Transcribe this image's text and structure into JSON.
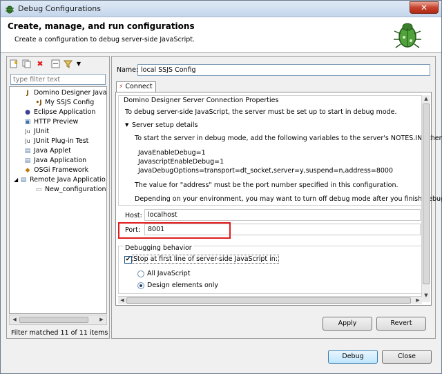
{
  "window": {
    "title": "Debug Configurations",
    "close_glyph": "✕"
  },
  "header": {
    "title": "Create, manage, and run configurations",
    "subtitle": "Create a configuration to debug server-side JavaScript."
  },
  "sidebar": {
    "filter_placeholder": "type filter text",
    "tree": [
      {
        "label": "Domino Designer JavaSc",
        "icon": "domino-js-icon",
        "glyph": "J"
      },
      {
        "label": "My SSJS Config",
        "icon": "js-config-icon",
        "glyph": "•J"
      },
      {
        "label": "Eclipse Application",
        "icon": "eclipse-icon",
        "glyph": "●"
      },
      {
        "label": "HTTP Preview",
        "icon": "http-icon",
        "glyph": "▣"
      },
      {
        "label": "JUnit",
        "icon": "junit-icon",
        "glyph": "Ju"
      },
      {
        "label": "JUnit Plug-in Test",
        "icon": "junit-plugin-icon",
        "glyph": "Ju"
      },
      {
        "label": "Java Applet",
        "icon": "applet-icon",
        "glyph": "▤"
      },
      {
        "label": "Java Application",
        "icon": "java-app-icon",
        "glyph": "▤"
      },
      {
        "label": "OSGi Framework",
        "icon": "osgi-icon",
        "glyph": "◆"
      },
      {
        "label": "Remote Java Applicatio",
        "icon": "remote-java-icon",
        "glyph": "▤"
      },
      {
        "label": "New_configuration",
        "icon": "config-icon",
        "glyph": "▭"
      }
    ],
    "status": "Filter matched 11 of 11 items"
  },
  "main": {
    "name_label": "Name:",
    "name_value": "local SSJS Config",
    "tab_label": "Connect",
    "group_title": "Domino Designer Server Connection Properties",
    "intro": "To debug server-side JavaScript, the server must be set up to start in debug mode.",
    "section_title": "Server setup details",
    "setup_text": "To start the server in debug mode, add the following variables to the server's NOTES.INI, then resta",
    "var1": "JavaEnableDebug=1",
    "var2": "JavascriptEnableDebug=1",
    "var3": "JavaDebugOptions=transport=dt_socket,server=y,suspend=n,address=8000",
    "address_note": "The value for \"address\" must be the port number specified in this configuration.",
    "env_note": "Depending on your environment, you may want to turn off debug mode after you finish debuggin",
    "host_label": "Host:",
    "host_value": "localhost",
    "port_label": "Port:",
    "port_value": "8001",
    "debug_group_title": "Debugging behavior",
    "stop_label": "Stop at first line of server-side JavaScript in:",
    "stop_checked": true,
    "radio_all": "All JavaScript",
    "radio_design": "Design elements only",
    "apply_label": "Apply",
    "revert_label": "Revert"
  },
  "footer": {
    "debug_label": "Debug",
    "close_label": "Close"
  },
  "colors": {
    "highlight_border": "#e01b1b",
    "title_gradient": "#c4d6ec"
  }
}
